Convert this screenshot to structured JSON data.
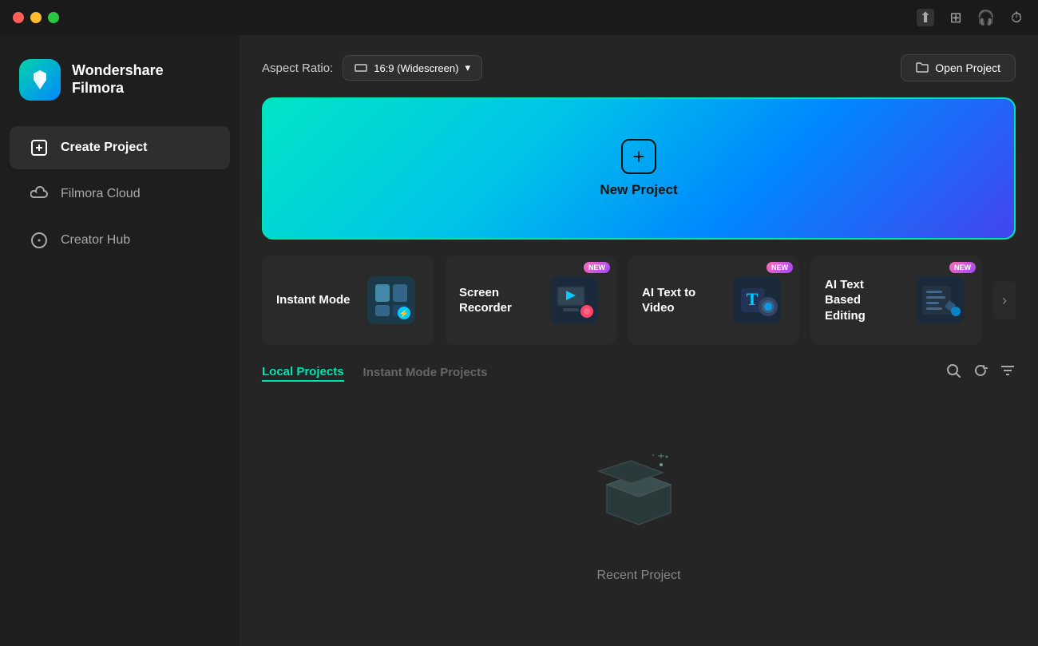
{
  "titlebar": {
    "buttons": [
      "close",
      "minimize",
      "maximize"
    ],
    "right_icons": [
      "upload-icon",
      "grid-icon",
      "headphones-icon",
      "clock-icon"
    ]
  },
  "sidebar": {
    "logo": {
      "title": "Wondershare",
      "subtitle": "Filmora"
    },
    "nav_items": [
      {
        "id": "create-project",
        "label": "Create Project",
        "icon": "plus-square",
        "active": true
      },
      {
        "id": "filmora-cloud",
        "label": "Filmora Cloud",
        "icon": "cloud",
        "active": false
      },
      {
        "id": "creator-hub",
        "label": "Creator Hub",
        "icon": "compass",
        "active": false
      }
    ]
  },
  "content": {
    "aspect_ratio": {
      "label": "Aspect Ratio:",
      "value": "16:9 (Widescreen)",
      "dropdown_icon": "chevron-down"
    },
    "open_project": {
      "label": "Open Project",
      "icon": "folder"
    },
    "new_project": {
      "label": "New Project"
    },
    "feature_cards": [
      {
        "id": "instant-mode",
        "label": "Instant Mode",
        "badge": null
      },
      {
        "id": "screen-recorder",
        "label": "Screen Recorder",
        "badge": "NEW"
      },
      {
        "id": "ai-text-to-video",
        "label": "AI Text to Video",
        "badge": "NEW"
      },
      {
        "id": "ai-text-based-editing",
        "label": "AI Text Based Editing",
        "badge": "NEW"
      }
    ],
    "projects": {
      "tabs": [
        {
          "id": "local",
          "label": "Local Projects",
          "active": true
        },
        {
          "id": "instant",
          "label": "Instant Mode Projects",
          "active": false
        }
      ],
      "actions": [
        "search-icon",
        "refresh-icon",
        "filter-icon"
      ],
      "empty_label": "Recent Project"
    }
  }
}
